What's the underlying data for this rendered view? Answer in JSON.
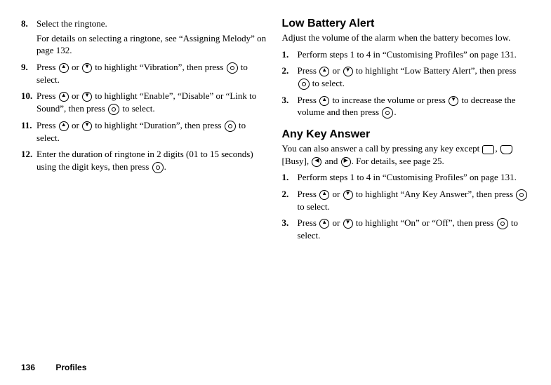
{
  "left": {
    "steps": [
      {
        "num": "8.",
        "text": "Select the ringtone.",
        "detail": "For details on selecting a ringtone, see “Assigning Melody” on page 132."
      },
      {
        "num": "9.",
        "pre": "Press ",
        "mid1": " or ",
        "mid2": " to highlight “Vibration”, then press ",
        "post": " to select."
      },
      {
        "num": "10.",
        "pre": "Press ",
        "mid1": " or ",
        "mid2": " to highlight “Enable”, “Disable” or “Link to Sound”, then press ",
        "post": " to select."
      },
      {
        "num": "11.",
        "pre": "Press ",
        "mid1": " or ",
        "mid2": " to highlight “Duration”, then press ",
        "post": " to select."
      },
      {
        "num": "12.",
        "pre": "Enter the duration of ringtone in 2 digits (01 to 15 seconds) using the digit keys, then press ",
        "post": "."
      }
    ]
  },
  "right": {
    "sections": [
      {
        "title": "Low Battery Alert",
        "desc": "Adjust the volume of the alarm when the battery becomes low.",
        "steps": [
          {
            "num": "1.",
            "text": "Perform steps 1 to 4 in “Customising Profiles” on page 131."
          },
          {
            "num": "2.",
            "pre": "Press ",
            "mid1": " or ",
            "mid2": " to highlight “Low Battery Alert”, then press ",
            "post": " to select."
          },
          {
            "num": "3.",
            "pre": "Press ",
            "mid1": " to increase the volume or press ",
            "mid2": " to decrease the volume and then press ",
            "post": "."
          }
        ]
      },
      {
        "title": "Any Key Answer",
        "descPre": "You can also answer a call by pressing any key except ",
        "descBusy": " [Busy], ",
        "descAnd": " and ",
        "descPost": ". For details, see page 25.",
        "steps": [
          {
            "num": "1.",
            "text": "Perform steps 1 to 4 in “Customising Profiles” on page 131."
          },
          {
            "num": "2.",
            "pre": "Press ",
            "mid1": " or ",
            "mid2": " to highlight “Any Key Answer”, then press ",
            "post": " to select."
          },
          {
            "num": "3.",
            "pre": "Press ",
            "mid1": " or ",
            "mid2": " to highlight “On” or “Off”, then press ",
            "post": " to select."
          }
        ]
      }
    ]
  },
  "footer": {
    "page": "136",
    "chapter": "Profiles"
  }
}
